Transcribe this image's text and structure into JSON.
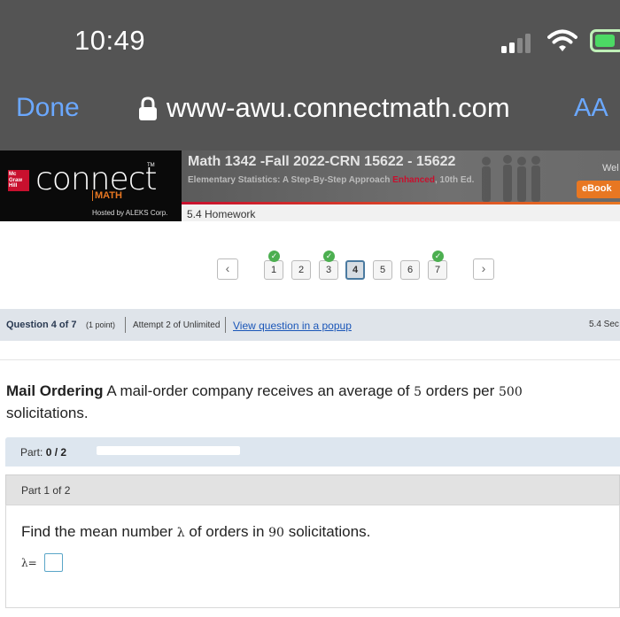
{
  "ios": {
    "time": "10:49",
    "done_label": "Done",
    "url": "www-awu.connectmath.com",
    "aa_label": "AA"
  },
  "colors": {
    "status_bar_bg": "#545454",
    "ios_link": "#6ba8ff",
    "brand_red": "#c8102e",
    "brand_orange": "#e87722",
    "info_bar_bg": "#dfe4ea",
    "link_blue": "#1a56b8",
    "check_green": "#4caf50"
  },
  "header": {
    "mh_badge": "Mc Graw Hill",
    "logo_word": "connect",
    "logo_tm": "TM",
    "logo_math": "MATH",
    "hosted_by": "Hosted by ALEKS Corp.",
    "course_title": "Math 1342 -Fall 2022-CRN 15622 - 15622",
    "book_subtitle_pre": "Elementary Statistics: A Step-By-Step Approach ",
    "book_enhanced": "Enhanced",
    "book_edition": ", 10th Ed.",
    "welcome": "Wel",
    "ebook_label": "eBook",
    "homework_label": "5.4 Homework"
  },
  "nav": {
    "prev_icon": "chevron-left-icon",
    "next_icon": "chevron-right-icon",
    "prev_glyph": "‹",
    "next_glyph": "›",
    "questions": [
      {
        "label": "1",
        "completed": true,
        "active": false
      },
      {
        "label": "2",
        "completed": false,
        "active": false
      },
      {
        "label": "3",
        "completed": true,
        "active": false
      },
      {
        "label": "4",
        "completed": false,
        "active": true
      },
      {
        "label": "5",
        "completed": false,
        "active": false
      },
      {
        "label": "6",
        "completed": false,
        "active": false
      },
      {
        "label": "7",
        "completed": true,
        "active": false
      }
    ],
    "check_glyph": "✓"
  },
  "info": {
    "question_num": "Question 4 of 7",
    "points": "(1 point)",
    "attempt": "Attempt 2 of Unlimited",
    "popup_link": "View question in a popup",
    "section": "5.4 Sec"
  },
  "question": {
    "title": "Mail Ordering",
    "text_1": " A mail-order company receives an average of ",
    "n1": "5",
    "text_2": " orders per ",
    "n2": "500",
    "text_3": " solicitations."
  },
  "parts": {
    "progress_label": "Part:",
    "progress_value": "0 / 2",
    "progress_fraction": 0,
    "part_header": "Part 1 of 2",
    "prompt_1": "Find the mean number ",
    "lambda": "λ",
    "prompt_2": " of orders in ",
    "n3": "90",
    "prompt_3": " solicitations.",
    "answer_label": "λ=",
    "answer_value": ""
  }
}
